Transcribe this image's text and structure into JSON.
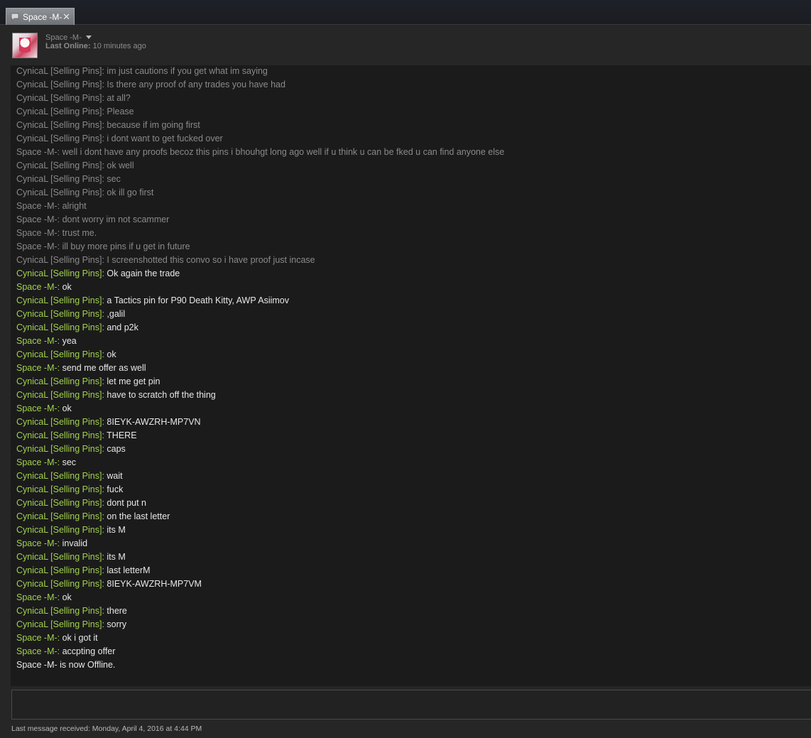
{
  "tab": {
    "label": "Space -M-",
    "close": "✕"
  },
  "friend": {
    "name": "Space -M-",
    "status_label": "Last Online:",
    "status_value": "10 minutes ago"
  },
  "messages": [
    {
      "who": "CynicaL [Selling Pins]",
      "text": "im just cautions if you get what im saying",
      "style": "old"
    },
    {
      "who": "CynicaL [Selling Pins]",
      "text": "Is there any proof of any trades you have had",
      "style": "old"
    },
    {
      "who": "CynicaL [Selling Pins]",
      "text": "at all?",
      "style": "old"
    },
    {
      "who": "CynicaL [Selling Pins]",
      "text": "Please",
      "style": "old"
    },
    {
      "who": "CynicaL [Selling Pins]",
      "text": "because if im going first",
      "style": "old"
    },
    {
      "who": "CynicaL [Selling Pins]",
      "text": "i dont want to get fucked over",
      "style": "old"
    },
    {
      "who": "Space -M-",
      "text": "well i dont have any proofs becoz this pins i bhouhgt long ago well if u think u can be fked u can find anyone else",
      "style": "old"
    },
    {
      "who": "CynicaL [Selling Pins]",
      "text": "ok well",
      "style": "old"
    },
    {
      "who": "CynicaL [Selling Pins]",
      "text": "sec",
      "style": "old"
    },
    {
      "who": "CynicaL [Selling Pins]",
      "text": "ok ill go first",
      "style": "old"
    },
    {
      "who": "Space -M-",
      "text": "alright",
      "style": "old"
    },
    {
      "who": "Space -M-",
      "text": "dont worry im not scammer",
      "style": "old"
    },
    {
      "who": "Space -M-",
      "text": "trust me.",
      "style": "old"
    },
    {
      "who": "Space -M-",
      "text": "ill buy more pins if u get in future",
      "style": "old"
    },
    {
      "who": "CynicaL [Selling Pins]",
      "text": "I screenshotted this convo so i have proof just incase",
      "style": "old"
    },
    {
      "who": "CynicaL [Selling Pins]",
      "text": "Ok again the trade",
      "style": "new"
    },
    {
      "who": "Space -M-",
      "text": "ok",
      "style": "new"
    },
    {
      "who": "CynicaL [Selling Pins]",
      "text": "a Tactics pin for P90 Death Kitty, AWP Asiimov",
      "style": "new"
    },
    {
      "who": "CynicaL [Selling Pins]",
      "text": ",galil",
      "style": "new"
    },
    {
      "who": "CynicaL [Selling Pins]",
      "text": "and p2k",
      "style": "new"
    },
    {
      "who": "Space -M-",
      "text": "yea",
      "style": "new"
    },
    {
      "who": "CynicaL [Selling Pins]",
      "text": "ok",
      "style": "new"
    },
    {
      "who": "Space -M-",
      "text": "send me offer as well",
      "style": "new"
    },
    {
      "who": "CynicaL [Selling Pins]",
      "text": "let me get pin",
      "style": "new"
    },
    {
      "who": "CynicaL [Selling Pins]",
      "text": "have to scratch off the thing",
      "style": "new"
    },
    {
      "who": "Space -M-",
      "text": "ok",
      "style": "new"
    },
    {
      "who": "CynicaL [Selling Pins]",
      "text": "8IEYK-AWZRH-MP7VN",
      "style": "new"
    },
    {
      "who": "CynicaL [Selling Pins]",
      "text": "THERE",
      "style": "new"
    },
    {
      "who": "CynicaL [Selling Pins]",
      "text": "caps",
      "style": "new"
    },
    {
      "who": "Space -M-",
      "text": "sec",
      "style": "new"
    },
    {
      "who": "CynicaL [Selling Pins]",
      "text": "wait",
      "style": "new"
    },
    {
      "who": "CynicaL [Selling Pins]",
      "text": "fuck",
      "style": "new"
    },
    {
      "who": "CynicaL [Selling Pins]",
      "text": "dont put n",
      "style": "new"
    },
    {
      "who": "CynicaL [Selling Pins]",
      "text": "on the last letter",
      "style": "new"
    },
    {
      "who": "CynicaL [Selling Pins]",
      "text": "its M",
      "style": "new"
    },
    {
      "who": "Space -M-",
      "text": "invalid",
      "style": "new"
    },
    {
      "who": "CynicaL [Selling Pins]",
      "text": "its M",
      "style": "new"
    },
    {
      "who": "CynicaL [Selling Pins]",
      "text": "last letterM",
      "style": "new"
    },
    {
      "who": "CynicaL [Selling Pins]",
      "text": "8IEYK-AWZRH-MP7VM",
      "style": "new"
    },
    {
      "who": "Space -M-",
      "text": "ok",
      "style": "new"
    },
    {
      "who": "CynicaL [Selling Pins]",
      "text": "there",
      "style": "new"
    },
    {
      "who": "CynicaL [Selling Pins]",
      "text": "sorry",
      "style": "new"
    },
    {
      "who": "Space -M-",
      "text": "ok i got it",
      "style": "new"
    },
    {
      "who": "Space -M-",
      "text": "accpting offer",
      "style": "new"
    },
    {
      "who": "",
      "text": "Space -M- is now Offline.",
      "style": "sys"
    }
  ],
  "footer": {
    "text": "Last message received: Monday, April 4, 2016 at 4:44 PM"
  },
  "colors": {
    "old_text": "#8a8a8a",
    "new_name": "#a2d14f",
    "new_text": "#e8e8e8",
    "log_background": "#1b1b1b"
  },
  "icons": {
    "tab": "chat-bubble-icon",
    "dropdown": "caret-down-icon"
  }
}
